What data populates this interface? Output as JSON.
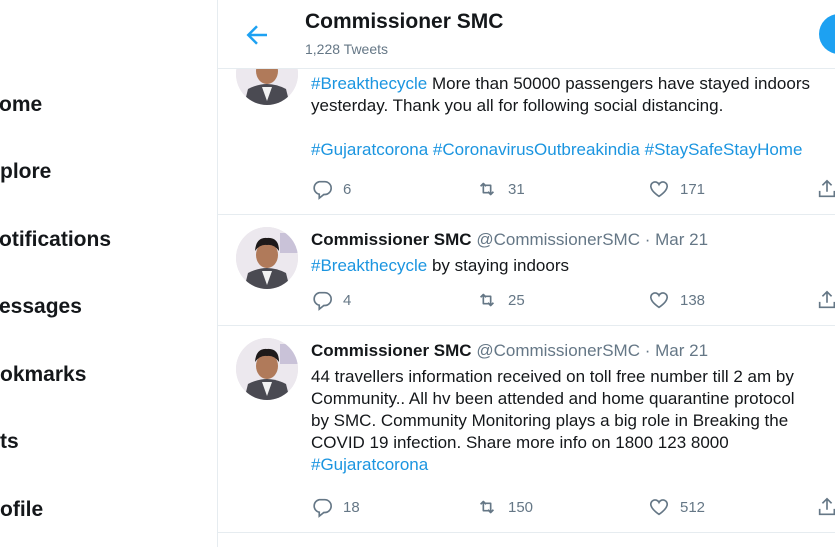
{
  "nav": [
    "ome",
    "plore",
    "otifications",
    "essages",
    "okmarks",
    "ts",
    "ofile"
  ],
  "header": {
    "title": "Commissioner SMC",
    "tweet_count": "1,228 Tweets"
  },
  "colors": {
    "accent": "#1da1f2",
    "link": "#1b95e0",
    "muted": "#657786"
  },
  "tweets": [
    {
      "lines": [
        [
          {
            "t": "#Breakthecycle",
            "tag": true
          },
          {
            "t": " More than 50000 passengers have stayed indoors",
            "tag": false
          }
        ],
        [
          {
            "t": "yesterday. Thank you all for following social distancing.",
            "tag": false
          }
        ],
        [
          {
            "t": "",
            "tag": false
          }
        ],
        [
          {
            "t": "#Gujaratcorona",
            "tag": true
          },
          {
            "t": " ",
            "tag": false
          },
          {
            "t": "#CoronavirusOutbreakindia",
            "tag": true
          },
          {
            "t": " ",
            "tag": false
          },
          {
            "t": "#StaySafeStayHome",
            "tag": true
          }
        ]
      ],
      "replies": "6",
      "retweets": "31",
      "likes": "171"
    },
    {
      "name": "Commissioner SMC",
      "handle": "@CommissionerSMC",
      "dot": "·",
      "date": "Mar 21",
      "lines": [
        [
          {
            "t": "#Breakthecycle",
            "tag": true
          },
          {
            "t": " by staying indoors",
            "tag": false
          }
        ]
      ],
      "replies": "4",
      "retweets": "25",
      "likes": "138"
    },
    {
      "name": "Commissioner SMC",
      "handle": "@CommissionerSMC",
      "dot": "·",
      "date": "Mar 21",
      "lines": [
        [
          {
            "t": "44 travellers information received on toll free number till 2 am by",
            "tag": false
          }
        ],
        [
          {
            "t": "Community.. All hv been attended and home quarantine protocol",
            "tag": false
          }
        ],
        [
          {
            "t": "by SMC. Community Monitoring plays a big role in Breaking the",
            "tag": false
          }
        ],
        [
          {
            "t": "COVID 19 infection. Share more info on 1800 123 8000",
            "tag": false
          }
        ],
        [
          {
            "t": "#Gujaratcorona",
            "tag": true
          }
        ]
      ],
      "replies": "18",
      "retweets": "150",
      "likes": "512"
    }
  ]
}
